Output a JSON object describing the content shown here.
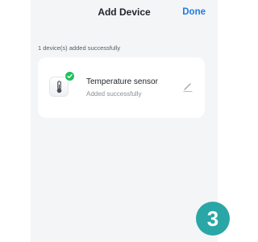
{
  "header": {
    "title": "Add Device",
    "done_label": "Done"
  },
  "summary": {
    "text": "1 device(s) added successfully"
  },
  "devices": [
    {
      "name": "Temperature sensor",
      "status": "Added successfully",
      "icon": "thermometer-icon",
      "status_icon": "check-icon"
    }
  ],
  "step": {
    "number": "3"
  },
  "colors": {
    "accent": "#1f7ae0",
    "success": "#20c05c",
    "step_badge": "#2aa6a6",
    "background": "#f4f5f7"
  }
}
